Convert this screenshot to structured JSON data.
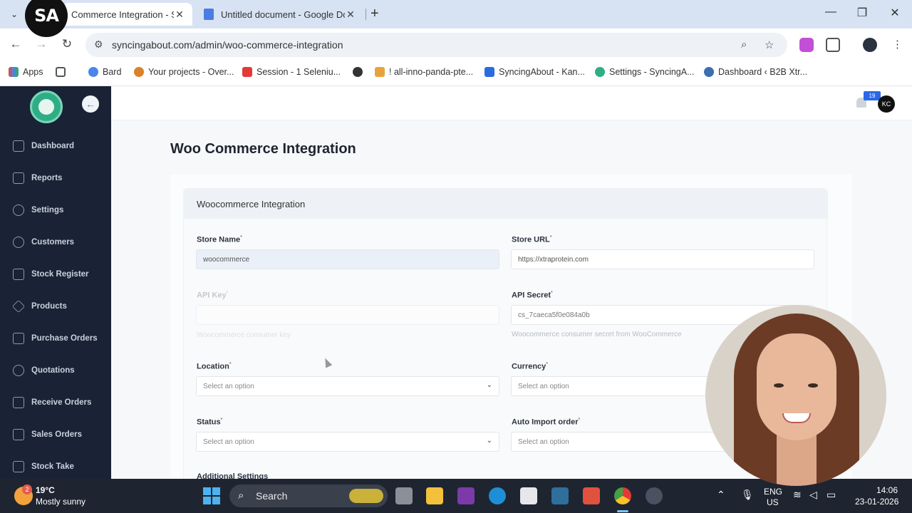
{
  "browser": {
    "logo_text": "SA",
    "tabs": [
      {
        "title": "Commerce Integration - S",
        "close": "✕"
      },
      {
        "title": "Untitled document - Google Do",
        "close": "✕"
      }
    ],
    "new_tab": "+",
    "window_controls": {
      "minimize": "—",
      "restore": "❐",
      "close": "✕"
    },
    "tab_menu": "⌄",
    "url": "syncingabout.com/admin/woo-commerce-integration",
    "nav": {
      "back": "←",
      "forward": "→",
      "reload": "↻"
    },
    "bookmarks": [
      {
        "label": "Apps",
        "color": "#e2453c"
      },
      {
        "label": "",
        "color": "#555555"
      },
      {
        "label": "Bard",
        "color": "#4a86e8"
      },
      {
        "label": "Your projects - Over...",
        "color": "#d9822b"
      },
      {
        "label": "Session - 1 Seleniu...",
        "color": "#e53935"
      },
      {
        "label": "",
        "color": "#333333"
      },
      {
        "label": "! all-inno-panda-pte...",
        "color": "#e9a23b"
      },
      {
        "label": "SyncingAbout - Kan...",
        "color": "#2a6ce0"
      },
      {
        "label": "Settings - SyncingA...",
        "color": "#2fae86"
      },
      {
        "label": "Dashboard ‹ B2B Xtr...",
        "color": "#3a6fb0"
      }
    ]
  },
  "sidebar": {
    "collapse_icon": "←",
    "items": [
      {
        "label": "Dashboard"
      },
      {
        "label": "Reports"
      },
      {
        "label": "Settings"
      },
      {
        "label": "Customers"
      },
      {
        "label": "Stock Register"
      },
      {
        "label": "Products"
      },
      {
        "label": "Purchase Orders"
      },
      {
        "label": "Quotations"
      },
      {
        "label": "Receive Orders"
      },
      {
        "label": "Sales Orders"
      },
      {
        "label": "Stock Take"
      }
    ]
  },
  "header": {
    "notification_count": "19",
    "avatar_initials": "KC"
  },
  "page": {
    "title": "Woo Commerce Integration",
    "card_title": "Woocommerce Integration"
  },
  "form": {
    "store_name": {
      "label": "Store Name",
      "value": "woocommerce"
    },
    "store_url": {
      "label": "Store URL",
      "value": "https://xtraprotein.com"
    },
    "api_key": {
      "label": "API Key",
      "value": "",
      "hint": "Woocommerce consumer key"
    },
    "api_secret": {
      "label": "API Secret",
      "value": "cs_7caeca5f0e084a0b",
      "hint": "Woocommerce consumer secret from WooCommerce"
    },
    "location": {
      "label": "Location",
      "placeholder": "Select an option"
    },
    "currency": {
      "label": "Currency",
      "placeholder": "Select an option"
    },
    "status": {
      "label": "Status",
      "placeholder": "Select an option"
    },
    "auto_import": {
      "label": "Auto Import order",
      "placeholder": "Select an option"
    },
    "additional_settings": "Additional Settings",
    "required_mark": "*",
    "chevron": "⌄"
  },
  "taskbar": {
    "weather_badge": "2",
    "temperature": "19°C",
    "weather": "Mostly sunny",
    "search_label": "Search",
    "language": "ENG",
    "region": "US",
    "time": "14:06",
    "date": "23-01-2026"
  }
}
